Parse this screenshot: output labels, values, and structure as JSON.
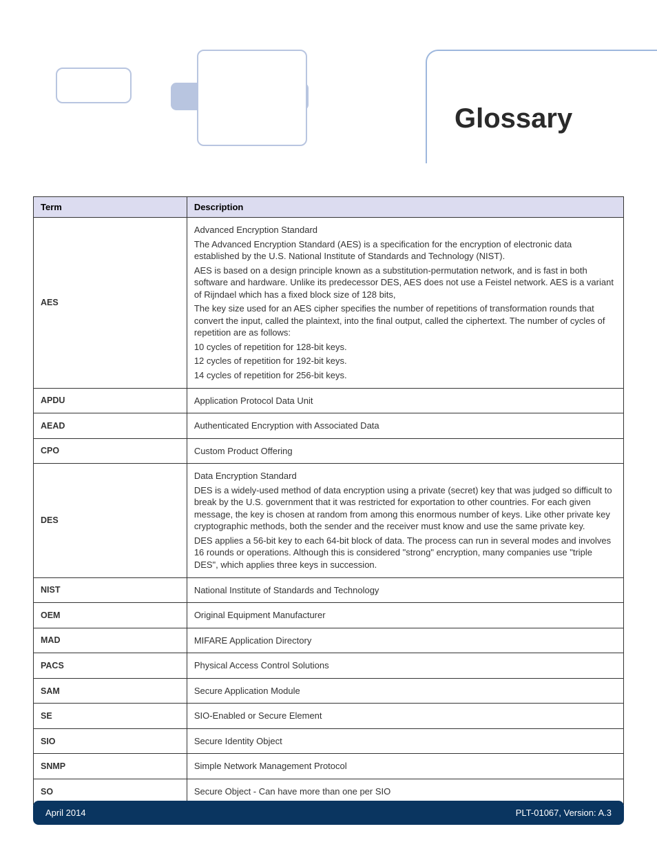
{
  "page_title": "Glossary",
  "table": {
    "headers": {
      "term": "Term",
      "description": "Description"
    },
    "rows": [
      {
        "term": "AES",
        "desc": [
          "Advanced Encryption Standard",
          "The Advanced Encryption Standard (AES) is a specification for the encryption of electronic data established by the U.S. National Institute of Standards and Technology (NIST).",
          "AES is based on a design principle known as a substitution-permutation network, and is fast in both software and hardware. Unlike its predecessor DES, AES does not use a Feistel network. AES is a variant of Rijndael which has a fixed block size of 128 bits,",
          "The key size used for an AES cipher specifies the number of repetitions of transformation rounds that convert the input, called the plaintext, into the final output, called the ciphertext. The number of cycles of repetition are as follows:",
          "10 cycles of repetition for 128-bit keys.",
          "12 cycles of repetition for 192-bit keys.",
          "14 cycles of repetition for 256-bit keys."
        ]
      },
      {
        "term": "APDU",
        "desc": [
          "Application Protocol Data Unit"
        ]
      },
      {
        "term": "AEAD",
        "desc": [
          "Authenticated Encryption with Associated Data"
        ]
      },
      {
        "term": "CPO",
        "desc": [
          "Custom Product Offering"
        ]
      },
      {
        "term": "DES",
        "desc": [
          "Data Encryption Standard",
          "DES is a widely-used method of data encryption using a private (secret) key that was judged so difficult to break by the U.S. government that it was restricted for exportation to other countries. For each given message, the key is chosen at random from among this enormous number of keys. Like other private key cryptographic methods, both the sender and the receiver must know and use the same private key.",
          "DES applies a 56-bit key to each 64-bit block of data. The process can run in several modes and involves 16 rounds or operations. Although this is considered \"strong\" encryption, many companies use \"triple DES\", which applies three keys in succession."
        ]
      },
      {
        "term": "NIST",
        "desc": [
          "National Institute of Standards and Technology"
        ]
      },
      {
        "term": "OEM",
        "desc": [
          "Original Equipment Manufacturer"
        ]
      },
      {
        "term": "MAD",
        "desc": [
          "MIFARE Application Directory"
        ]
      },
      {
        "term": "PACS",
        "desc": [
          "Physical Access Control Solutions"
        ]
      },
      {
        "term": "SAM",
        "desc": [
          "Secure Application Module"
        ]
      },
      {
        "term": "SE",
        "desc": [
          "SIO-Enabled or Secure Element"
        ]
      },
      {
        "term": "SIO",
        "desc": [
          "Secure Identity Object"
        ]
      },
      {
        "term": "SNMP",
        "desc": [
          "Simple Network Management Protocol"
        ]
      },
      {
        "term": "SO",
        "desc": [
          "Secure Object - Can have more than one per SIO"
        ]
      }
    ]
  },
  "footer": {
    "left": "April 2014",
    "right": "PLT-01067, Version: A.3"
  }
}
